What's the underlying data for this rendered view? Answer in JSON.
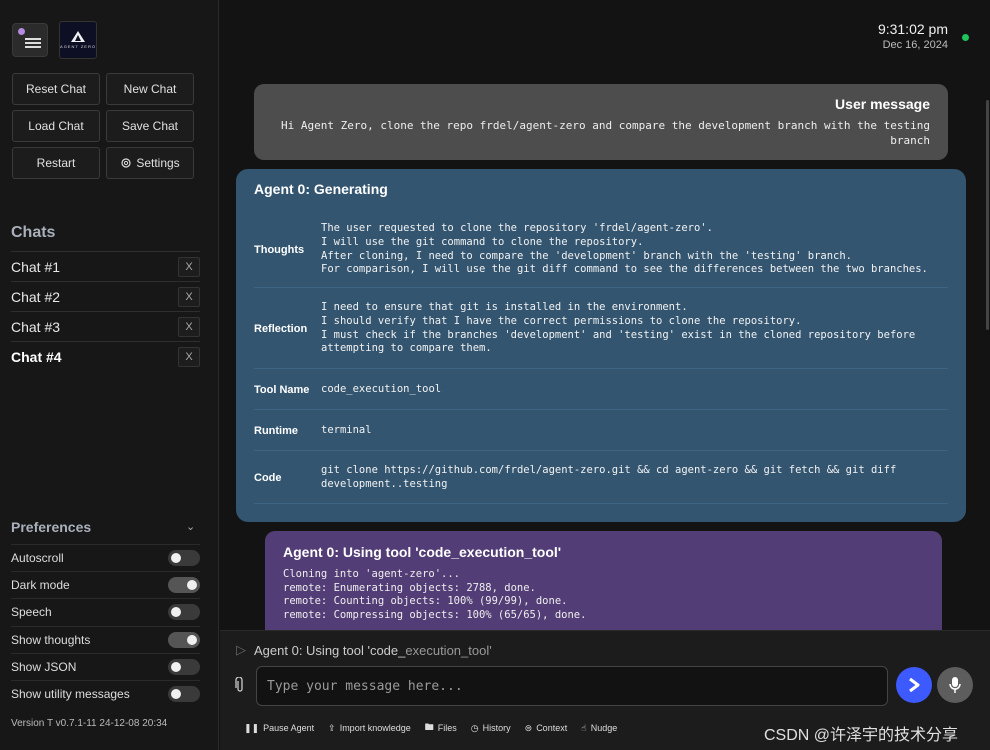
{
  "sidebar": {
    "logo_text": "AGENT ZERO",
    "buttons": {
      "reset_chat": "Reset Chat",
      "new_chat": "New Chat",
      "load_chat": "Load Chat",
      "save_chat": "Save Chat",
      "restart": "Restart",
      "settings": "Settings"
    },
    "chats_title": "Chats",
    "chats": [
      {
        "name": "Chat #1",
        "close": "X"
      },
      {
        "name": "Chat #2",
        "close": "X"
      },
      {
        "name": "Chat #3",
        "close": "X"
      },
      {
        "name": "Chat #4",
        "close": "X"
      }
    ],
    "preferences_title": "Preferences",
    "preferences": [
      {
        "label": "Autoscroll",
        "on": false
      },
      {
        "label": "Dark mode",
        "on": true
      },
      {
        "label": "Speech",
        "on": false
      },
      {
        "label": "Show thoughts",
        "on": true
      },
      {
        "label": "Show JSON",
        "on": false
      },
      {
        "label": "Show utility messages",
        "on": false
      }
    ],
    "version": "Version T v0.7.1-11 24-12-08 20:34"
  },
  "header": {
    "time": "9:31:02 pm",
    "date": "Dec 16, 2024",
    "status_color": "#1fc35b"
  },
  "messages": {
    "user": {
      "title": "User message",
      "text": "Hi Agent Zero, clone the repo frdel/agent-zero and compare the development branch with the testing branch"
    },
    "agent": {
      "title": "Agent 0: Generating",
      "rows": [
        {
          "key": "Thoughts",
          "value": "The user requested to clone the repository 'frdel/agent-zero'.\nI will use the git command to clone the repository.\nAfter cloning, I need to compare the 'development' branch with the 'testing' branch.\nFor comparison, I will use the git diff command to see the differences between the two branches."
        },
        {
          "key": "Reflection",
          "value": "I need to ensure that git is installed in the environment.\nI should verify that I have the correct permissions to clone the repository.\nI must check if the branches 'development' and 'testing' exist in the cloned repository before\nattempting to compare them."
        },
        {
          "key": "Tool Name",
          "value": "code_execution_tool"
        },
        {
          "key": "Runtime",
          "value": "terminal"
        },
        {
          "key": "Code",
          "value": "git clone https://github.com/frdel/agent-zero.git && cd agent-zero && git fetch && git diff\ndevelopment..testing"
        }
      ]
    },
    "tool": {
      "title": "Agent 0: Using tool 'code_execution_tool'",
      "output": "Cloning into 'agent-zero'...\nremote: Enumerating objects: 2788, done.\nremote: Counting objects: 100% (99/99), done.\nremote: Compressing objects: 100% (65/65), done."
    }
  },
  "input_area": {
    "progress_prefix": "Agent 0: Using tool 'code_",
    "progress_suffix": "execution_tool'",
    "placeholder": "Type your message here...",
    "actions": [
      "Pause Agent",
      "Import knowledge",
      "Files",
      "History",
      "Context",
      "Nudge"
    ],
    "send_color": "#3d5afe"
  },
  "watermark": "CSDN @许泽宇的技术分享"
}
